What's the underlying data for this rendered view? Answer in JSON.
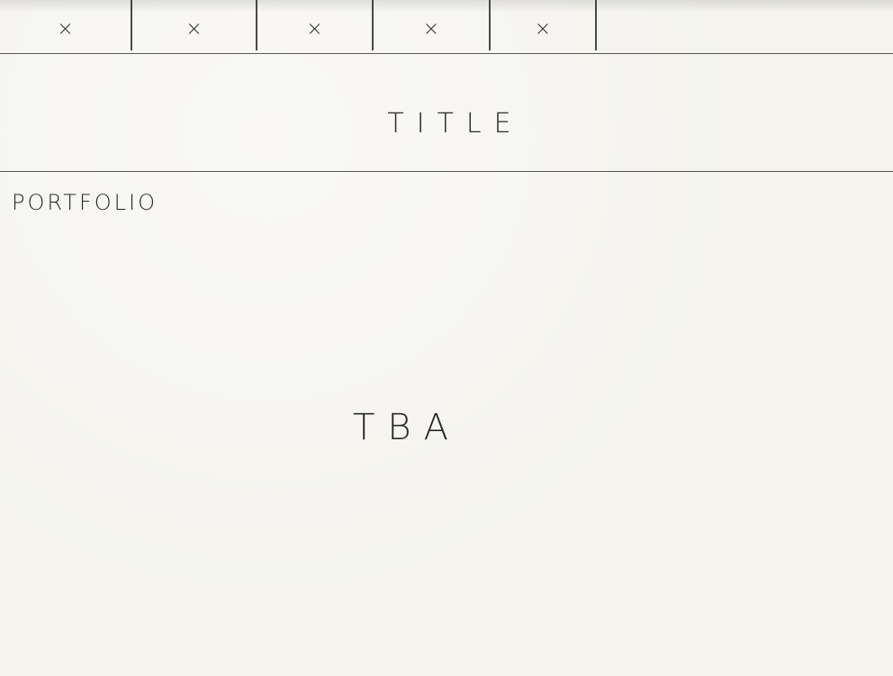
{
  "nav": {
    "items": [
      {
        "label": "×",
        "icon": "x-icon"
      },
      {
        "label": "×",
        "icon": "x-icon"
      },
      {
        "label": "×",
        "icon": "x-icon"
      },
      {
        "label": "×",
        "icon": "x-icon"
      },
      {
        "label": "×",
        "icon": "x-icon"
      }
    ]
  },
  "header": {
    "title": "TITLE"
  },
  "main": {
    "section_label": "PORTFOLIO",
    "placeholder_text": "TBA"
  }
}
